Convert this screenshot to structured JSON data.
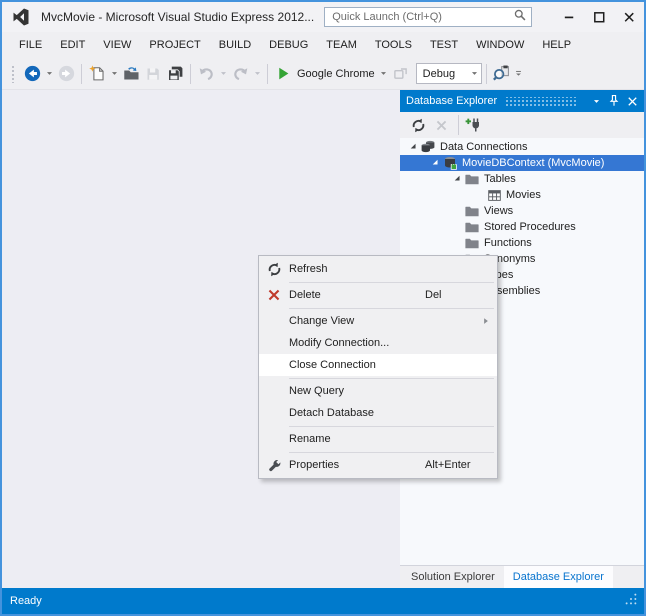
{
  "window": {
    "title": "MvcMovie - Microsoft Visual Studio Express 2012...",
    "quick_launch_placeholder": "Quick Launch (Ctrl+Q)"
  },
  "menubar": {
    "items": [
      "FILE",
      "EDIT",
      "VIEW",
      "PROJECT",
      "BUILD",
      "DEBUG",
      "TEAM",
      "TOOLS",
      "TEST",
      "WINDOW",
      "HELP"
    ]
  },
  "toolbar": {
    "run_target_label": "Google Chrome",
    "configuration_label": "Debug"
  },
  "panel": {
    "title": "Database Explorer",
    "tree": [
      {
        "label": "Data Connections",
        "level": 0,
        "expanded": true,
        "icon": "database-stack"
      },
      {
        "label": "MovieDBContext (MvcMovie)",
        "level": 1,
        "expanded": true,
        "selected": true,
        "icon": "database-connection"
      },
      {
        "label": "Tables",
        "level": 2,
        "expanded": true,
        "icon": "folder"
      },
      {
        "label": "Movies",
        "level": 3,
        "icon": "table"
      },
      {
        "label": "Views",
        "level": 2,
        "icon": "folder"
      },
      {
        "label": "Stored Procedures",
        "level": 2,
        "icon": "folder"
      },
      {
        "label": "Functions",
        "level": 2,
        "icon": "folder"
      },
      {
        "label": "Synonyms",
        "level": 2,
        "icon": "folder"
      },
      {
        "label": "Types",
        "level": 2,
        "icon": "folder"
      },
      {
        "label": "Assemblies",
        "level": 2,
        "icon": "folder"
      }
    ],
    "tabs": [
      {
        "label": "Solution Explorer",
        "active": false
      },
      {
        "label": "Database Explorer",
        "active": true
      }
    ]
  },
  "context_menu": {
    "items": [
      {
        "label": "Refresh",
        "icon": "refresh-dark"
      },
      {
        "separator": true
      },
      {
        "label": "Delete",
        "icon": "x-red",
        "shortcut": "Del"
      },
      {
        "separator": true
      },
      {
        "label": "Change View",
        "submenu": true
      },
      {
        "label": "Modify Connection..."
      },
      {
        "label": "Close Connection",
        "highlighted": true
      },
      {
        "separator": true
      },
      {
        "label": "New Query"
      },
      {
        "label": "Detach Database"
      },
      {
        "separator": true
      },
      {
        "label": "Rename"
      },
      {
        "separator": true
      },
      {
        "label": "Properties",
        "icon": "wrench",
        "shortcut": "Alt+Enter"
      }
    ]
  },
  "statusbar": {
    "text": "Ready"
  },
  "colors": {
    "accent_blue": "#007ACC",
    "selection_blue": "#3577D3",
    "window_border": "#4493dd",
    "chrome_bg": "#EFEFF2",
    "menu_bg": "#F0F0F2",
    "menu_highlight": "#FFFFFF",
    "delete_red": "#C03A2B",
    "run_green": "#35A435"
  }
}
